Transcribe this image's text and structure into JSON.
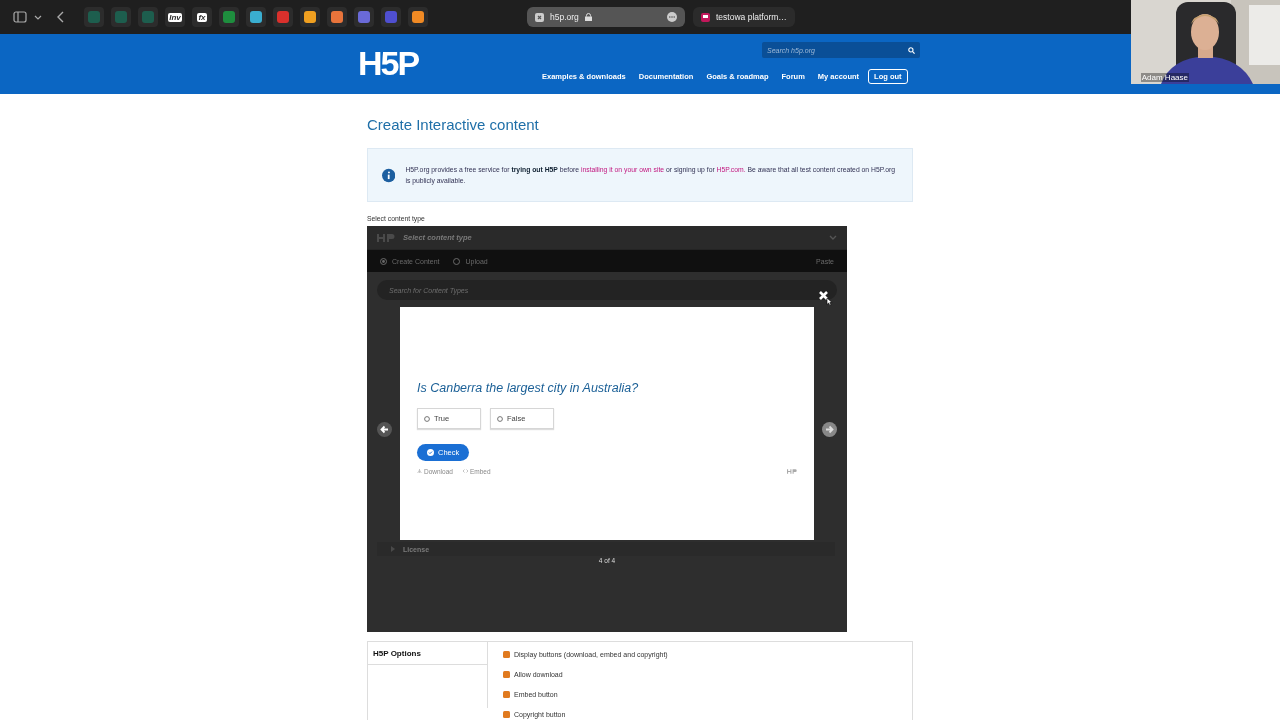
{
  "browser": {
    "favicons": [
      {
        "color": "#1d5e4e"
      },
      {
        "color": "#1d5e4e"
      },
      {
        "color": "#1d5e4e"
      },
      {
        "color": "#2f2f2f",
        "label": "Inv"
      },
      {
        "color": "#2f2f2f",
        "label": "fx"
      },
      {
        "color": "#1e8e3e"
      },
      {
        "color": "#3aaed0"
      },
      {
        "color": "#d9302c"
      },
      {
        "color": "#f0a020"
      },
      {
        "color": "#e8743b"
      },
      {
        "color": "#6a6ad8"
      },
      {
        "color": "#4f4fd0"
      },
      {
        "color": "#f08a24"
      }
    ],
    "tabs": [
      {
        "title": "h5p.org",
        "selected": true
      },
      {
        "title": "testowa platform…",
        "selected": false
      }
    ]
  },
  "header": {
    "logo": "H5P",
    "search": {
      "placeholder": "Search h5p.org"
    },
    "nav": [
      "Examples & downloads",
      "Documentation",
      "Goals & roadmap",
      "Forum",
      "My account"
    ],
    "logout": "Log out"
  },
  "webcam": {
    "name": "Adam Haase"
  },
  "page_title": "Create Interactive content",
  "info": [
    {
      "kind": "text",
      "text": "H5P.org provides a free service for **trying out H5P** before"
    },
    {
      "kind": "link",
      "text": "installing it on your own site"
    },
    {
      "kind": "text",
      "text": "or signing up for"
    },
    {
      "kind": "link",
      "text": "H5P.com."
    },
    {
      "kind": "text",
      "text": "Be aware that all test content created on H5P.org is publicly available."
    }
  ],
  "field_label": "Select content type",
  "hub": {
    "title": "Select content type",
    "tabs": [
      {
        "label": "Create Content",
        "selected": true
      },
      {
        "label": "Upload",
        "selected": false
      }
    ],
    "paste": "Paste",
    "search": {
      "placeholder": "Search for Content Types"
    },
    "license": "License"
  },
  "lightbox": {
    "question": "Is Canberra the largest city in Australia?",
    "answers": [
      {
        "label": "True",
        "selected": false
      },
      {
        "label": "False",
        "selected": false
      }
    ],
    "check": "Check",
    "actions": [
      "Download",
      "Embed"
    ],
    "counter": "4 of 4"
  },
  "options": {
    "title": "H5P Options",
    "items": [
      {
        "label": "Display buttons (download, embed and copyright)",
        "checked": true
      },
      {
        "label": "Allow download",
        "checked": true
      },
      {
        "label": "Embed button",
        "checked": true
      },
      {
        "label": "Copyright button",
        "checked": true
      }
    ]
  }
}
